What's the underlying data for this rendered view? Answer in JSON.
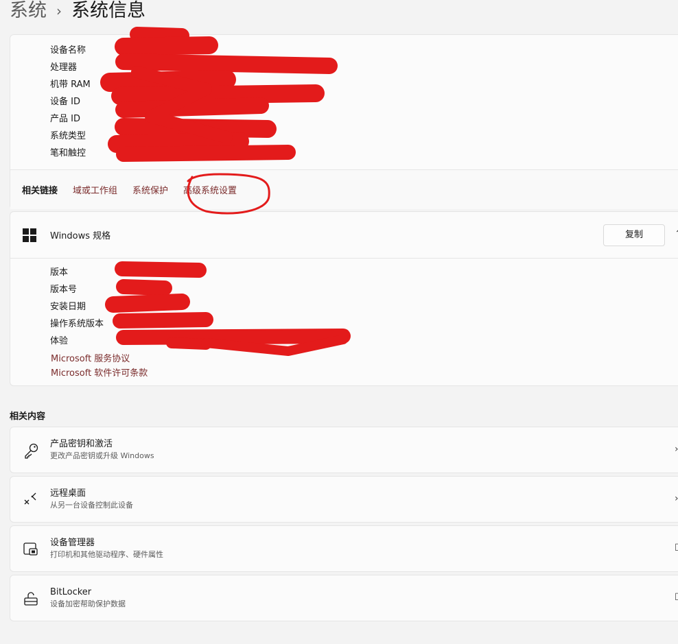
{
  "breadcrumb": {
    "parent": "系统",
    "separator": "›",
    "current": "系统信息"
  },
  "device_specs": {
    "rows": [
      {
        "label": "设备名称"
      },
      {
        "label": "处理器"
      },
      {
        "label": "机带 RAM"
      },
      {
        "label": "设备 ID"
      },
      {
        "label": "产品 ID"
      },
      {
        "label": "系统类型"
      },
      {
        "label": "笔和触控"
      }
    ]
  },
  "related_links": {
    "title": "相关链接",
    "links": [
      "域或工作组",
      "系统保护",
      "高级系统设置"
    ]
  },
  "windows_spec": {
    "title": "Windows 规格",
    "copy_label": "复制",
    "rows": [
      {
        "label": "版本"
      },
      {
        "label": "版本号"
      },
      {
        "label": "安装日期"
      },
      {
        "label": "操作系统版本"
      },
      {
        "label": "体验"
      }
    ],
    "links": [
      "Microsoft 服务协议",
      "Microsoft 软件许可条款"
    ]
  },
  "related_content": {
    "title": "相关内容",
    "items": [
      {
        "title": "产品密钥和激活",
        "subtitle": "更改产品密钥或升级 Windows",
        "icon": "key-icon"
      },
      {
        "title": "远程桌面",
        "subtitle": "从另一台设备控制此设备",
        "icon": "remote-desktop-icon"
      },
      {
        "title": "设备管理器",
        "subtitle": "打印机和其他驱动程序、硬件属性",
        "icon": "device-manager-icon"
      },
      {
        "title": "BitLocker",
        "subtitle": "设备加密帮助保护数据",
        "icon": "lock-icon"
      }
    ]
  },
  "colors": {
    "link": "#7a2b2b",
    "background": "#f3f3f3",
    "card": "#fbfbfb",
    "redaction": "#e31b1b"
  }
}
